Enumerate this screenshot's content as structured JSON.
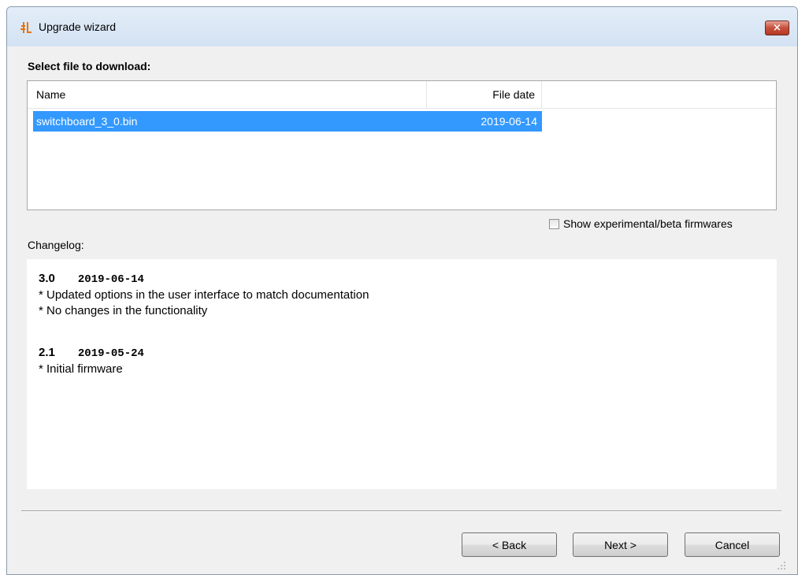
{
  "window": {
    "title": "Upgrade wizard",
    "close_label": "×"
  },
  "file_section": {
    "heading": "Select file to download:",
    "columns": {
      "name": "Name",
      "file_date": "File date"
    },
    "rows": [
      {
        "name": "switchboard_3_0.bin",
        "file_date": "2019-06-14",
        "selected": true
      }
    ]
  },
  "options": {
    "show_beta_label": "Show experimental/beta firmwares",
    "show_beta_checked": false
  },
  "changelog": {
    "label": "Changelog:",
    "entries": [
      {
        "version": "3.0",
        "date": "2019-06-14",
        "lines": [
          "* Updated options in the user interface to match documentation",
          "* No changes in the functionality"
        ]
      },
      {
        "version": "2.1",
        "date": "2019-05-24",
        "lines": [
          "* Initial firmware"
        ]
      }
    ]
  },
  "buttons": {
    "back": "< Back",
    "next": "Next >",
    "cancel": "Cancel"
  },
  "colors": {
    "selection": "#3399ff",
    "close_button": "#c7503c",
    "app_icon": "#e8740c"
  },
  "icons": {
    "app": "app-logo-icon",
    "close": "close-icon",
    "resize": "resize-grip-icon"
  }
}
